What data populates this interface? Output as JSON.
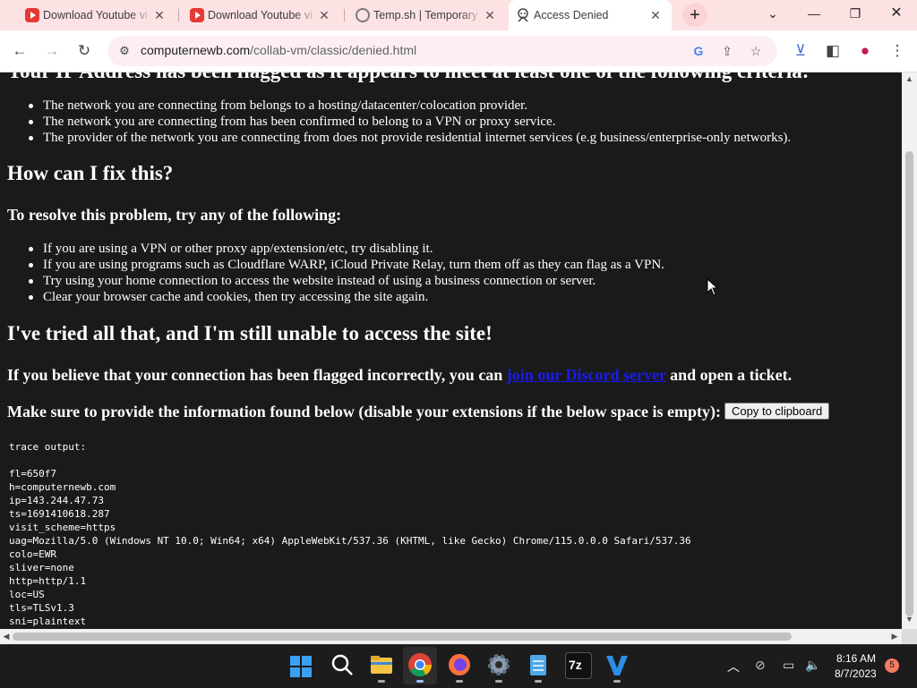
{
  "browser": {
    "tabs": [
      {
        "title": "Download Youtube vi",
        "icon": "youtube-icon"
      },
      {
        "title": "Download Youtube vi",
        "icon": "youtube-icon"
      },
      {
        "title": "Temp.sh | Temporary",
        "icon": "globe-icon"
      },
      {
        "title": "Access Denied",
        "icon": "hacker-icon"
      }
    ],
    "url_host": "computernewb.com",
    "url_path": "/collab-vm/classic/denied.html"
  },
  "page": {
    "cut_heading": "Your IP Address has been flagged as it appears to meet at least one of the following criteria:",
    "reasons": [
      "The network you are connecting from belongs to a hosting/datacenter/colocation provider.",
      "The network you are connecting from has been confirmed to belong to a VPN or proxy service.",
      "The provider of the network you are connecting from does not provide residential internet services (e.g business/enterprise-only networks)."
    ],
    "fix_heading": "How can I fix this?",
    "resolve_heading": "To resolve this problem, try any of the following:",
    "fixes": [
      "If you are using a VPN or other proxy app/extension/etc, try disabling it.",
      "If you are using programs such as Cloudflare WARP, iCloud Private Relay, turn them off as they can flag as a VPN.",
      "Try using your home connection to access the website instead of using a business connection or server.",
      "Clear your browser cache and cookies, then try accessing the site again."
    ],
    "tried_heading": "I've tried all that, and I'm still unable to access the site!",
    "believe_pre": "If you believe that your connection has been flagged incorrectly, you can ",
    "discord_link": "join our Discord server",
    "believe_post": " and open a ticket.",
    "info_text": "Make sure to provide the information found below (disable your extensions if the below space is empty):",
    "copy_button": "Copy to clipboard",
    "trace": "trace output:\n\nfl=650f7\nh=computernewb.com\nip=143.244.47.73\nts=1691410618.287\nvisit_scheme=https\nuag=Mozilla/5.0 (Windows NT 10.0; Win64; x64) AppleWebKit/537.36 (KHTML, like Gecko) Chrome/115.0.0.0 Safari/537.36\ncolo=EWR\nsliver=none\nhttp=http/1.1\nloc=US\ntls=TLSv1.3\nsni=plaintext"
  },
  "taskbar": {
    "time": "8:16 AM",
    "date": "8/7/2023",
    "notification_count": "5",
    "sevenzip_label": "7z"
  },
  "colors": {
    "tab_strip": "#fde2e4",
    "page_background": "#1a1a1a",
    "link": "#1a1aee"
  }
}
